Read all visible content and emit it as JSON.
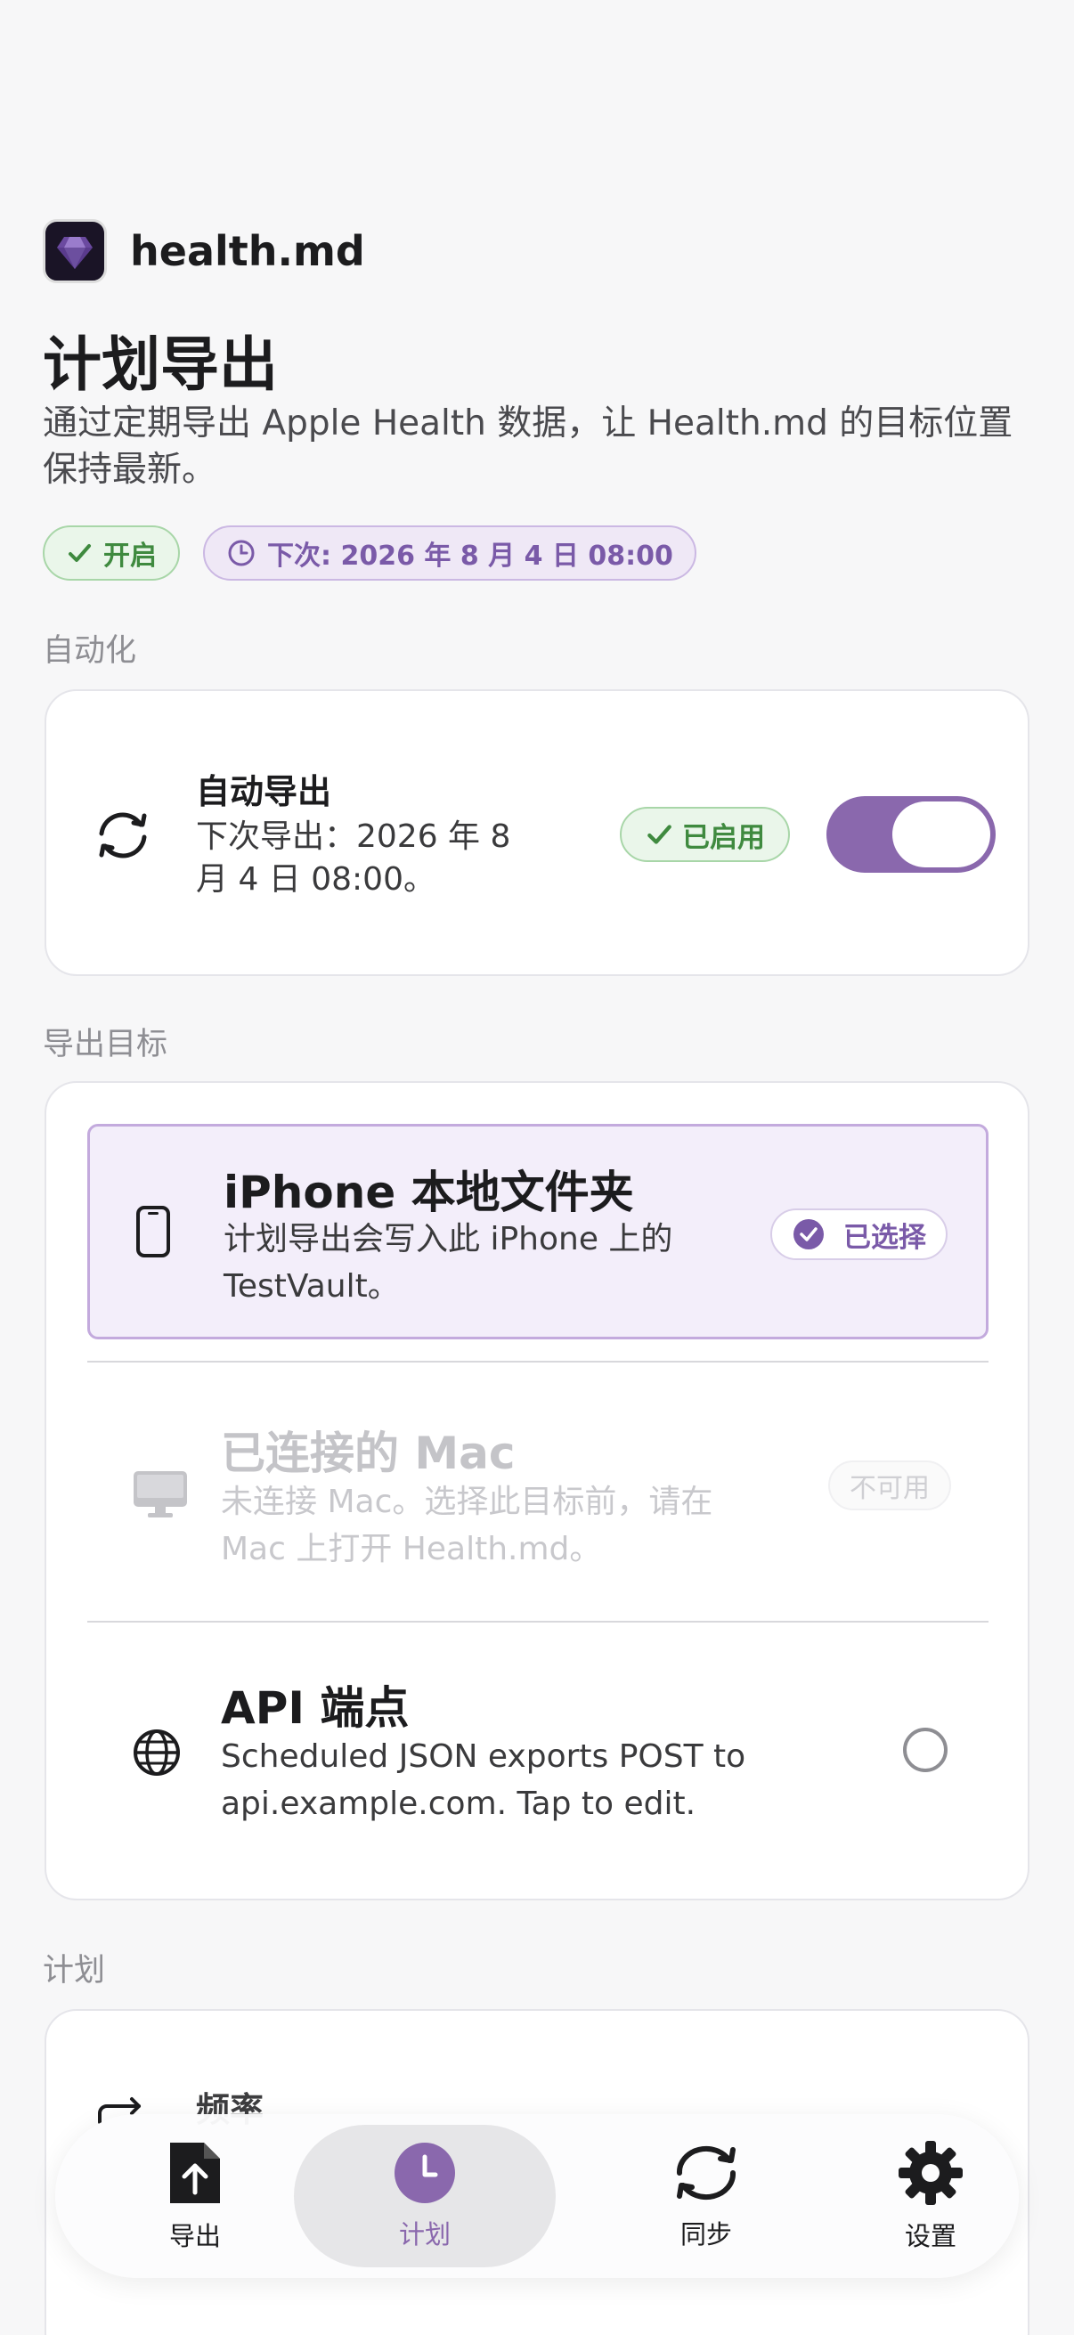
{
  "app": {
    "name": "health.md"
  },
  "page": {
    "title": "计划导出",
    "subtitle": "通过定期导出 Apple Health 数据，让 Health.md 的目标位置保持最新。"
  },
  "status_chips": {
    "enabled": "开启",
    "next": "下次: 2026 年 8 月 4 日 08:00"
  },
  "sections": {
    "automation": "自动化",
    "targets": "导出目标",
    "schedule": "计划"
  },
  "automation": {
    "title": "自动导出",
    "subtitle": "下次导出：2026 年 8 月 4 日 08:00。",
    "badge": "已启用",
    "toggle_on": true
  },
  "targets": [
    {
      "title": "iPhone 本地文件夹",
      "subtitle": "计划导出会写入此 iPhone 上的 TestVault。",
      "badge": "已选择",
      "icon": "iphone-icon"
    },
    {
      "title": "已连接的 Mac",
      "subtitle": "未连接 Mac。选择此目标前，请在 Mac 上打开 Health.md。",
      "badge": "不可用",
      "icon": "mac-icon"
    },
    {
      "title": "API 端点",
      "subtitle": "Scheduled JSON exports POST to api.example.com. Tap to edit.",
      "icon": "globe-icon"
    }
  ],
  "schedule": {
    "frequency_title": "频率"
  },
  "tabbar": {
    "items": [
      {
        "label": "导出",
        "icon": "export-doc-icon"
      },
      {
        "label": "计划",
        "icon": "clock-icon"
      },
      {
        "label": "同步",
        "icon": "sync-icon"
      },
      {
        "label": "设置",
        "icon": "gear-icon"
      }
    ],
    "active_index": 1
  },
  "colors": {
    "accent": "#8a68ad",
    "success": "#3f8a3f"
  }
}
